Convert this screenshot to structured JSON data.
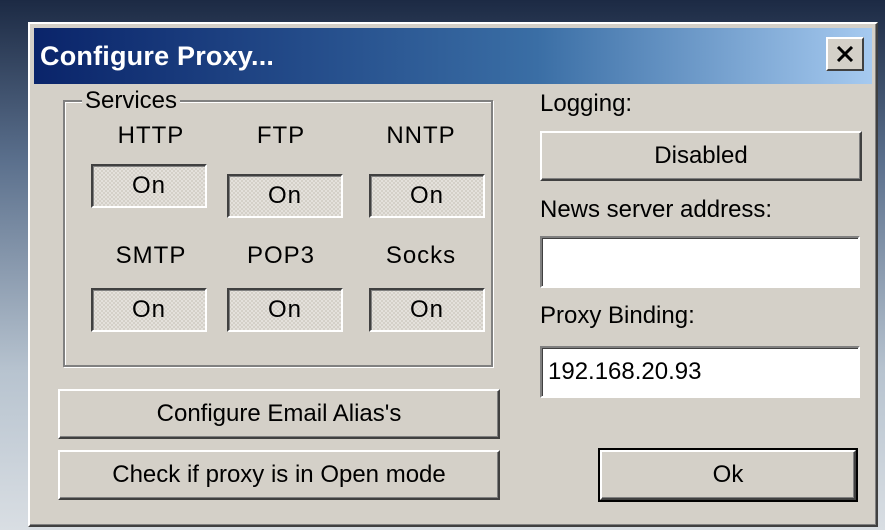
{
  "window": {
    "title": "Configure Proxy...",
    "close_label": "×"
  },
  "services": {
    "group_label": "Services",
    "items": [
      {
        "name": "HTTP",
        "state": "On"
      },
      {
        "name": "FTP",
        "state": "On"
      },
      {
        "name": "NNTP",
        "state": "On"
      },
      {
        "name": "SMTP",
        "state": "On"
      },
      {
        "name": "POP3",
        "state": "On"
      },
      {
        "name": "Socks",
        "state": "On"
      }
    ]
  },
  "buttons": {
    "configure_email_alias": "Configure Email Alias's",
    "check_open_mode": "Check if proxy is in Open mode",
    "ok": "Ok"
  },
  "logging": {
    "label": "Logging:",
    "value": "Disabled"
  },
  "news_server": {
    "label": "News server address:",
    "value": ""
  },
  "proxy_binding": {
    "label": "Proxy Binding:",
    "value": "192.168.20.93"
  },
  "colors": {
    "titlebar_start": "#0a246a",
    "titlebar_end": "#a6caf0",
    "face": "#d4d0c8"
  }
}
